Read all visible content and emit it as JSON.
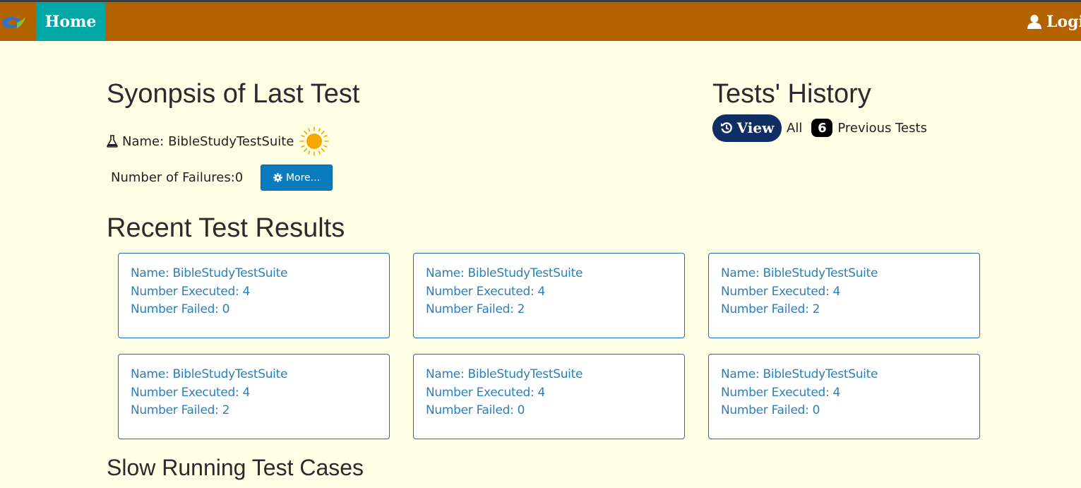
{
  "nav": {
    "home_label": "Home",
    "login_label": "Logi"
  },
  "synopsis": {
    "title": "Syonpsis of Last Test",
    "name_prefix": "Name:",
    "name_value": "BibleStudyTestSuite",
    "failures_label": "Number of Failures:",
    "failures_value": "0",
    "more_button": "More..."
  },
  "history": {
    "title": "Tests' History",
    "view_button": "View",
    "all_label": "All",
    "count": "6",
    "previous_label": "Previous Tests"
  },
  "recent": {
    "title": "Recent Test Results",
    "cards": [
      {
        "name": "Name: BibleStudyTestSuite",
        "executed": "Number Executed: 4",
        "failed": "Number Failed: 0"
      },
      {
        "name": "Name: BibleStudyTestSuite",
        "executed": "Number Executed: 4",
        "failed": "Number Failed: 2"
      },
      {
        "name": "Name: BibleStudyTestSuite",
        "executed": "Number Executed: 4",
        "failed": "Number Failed: 2"
      },
      {
        "name": "Name: BibleStudyTestSuite",
        "executed": "Number Executed: 4",
        "failed": "Number Failed: 2"
      },
      {
        "name": "Name: BibleStudyTestSuite",
        "executed": "Number Executed: 4",
        "failed": "Number Failed: 0"
      },
      {
        "name": "Name: BibleStudyTestSuite",
        "executed": "Number Executed: 4",
        "failed": "Number Failed: 0"
      }
    ]
  },
  "slow": {
    "title": "Slow Running Test Cases"
  },
  "icons": {
    "logo": "app-logo",
    "user": "user-icon",
    "flask": "flask-icon",
    "status": "sun-icon",
    "gear": "gear-icon",
    "history": "history-icon"
  },
  "colors": {
    "topbar": "#b36200",
    "home_tab": "#00a7a5",
    "page_bg": "#ffffe5",
    "more_button": "#0a7bbd",
    "view_button": "#0f2f64",
    "card_text": "#2c7fbd"
  }
}
